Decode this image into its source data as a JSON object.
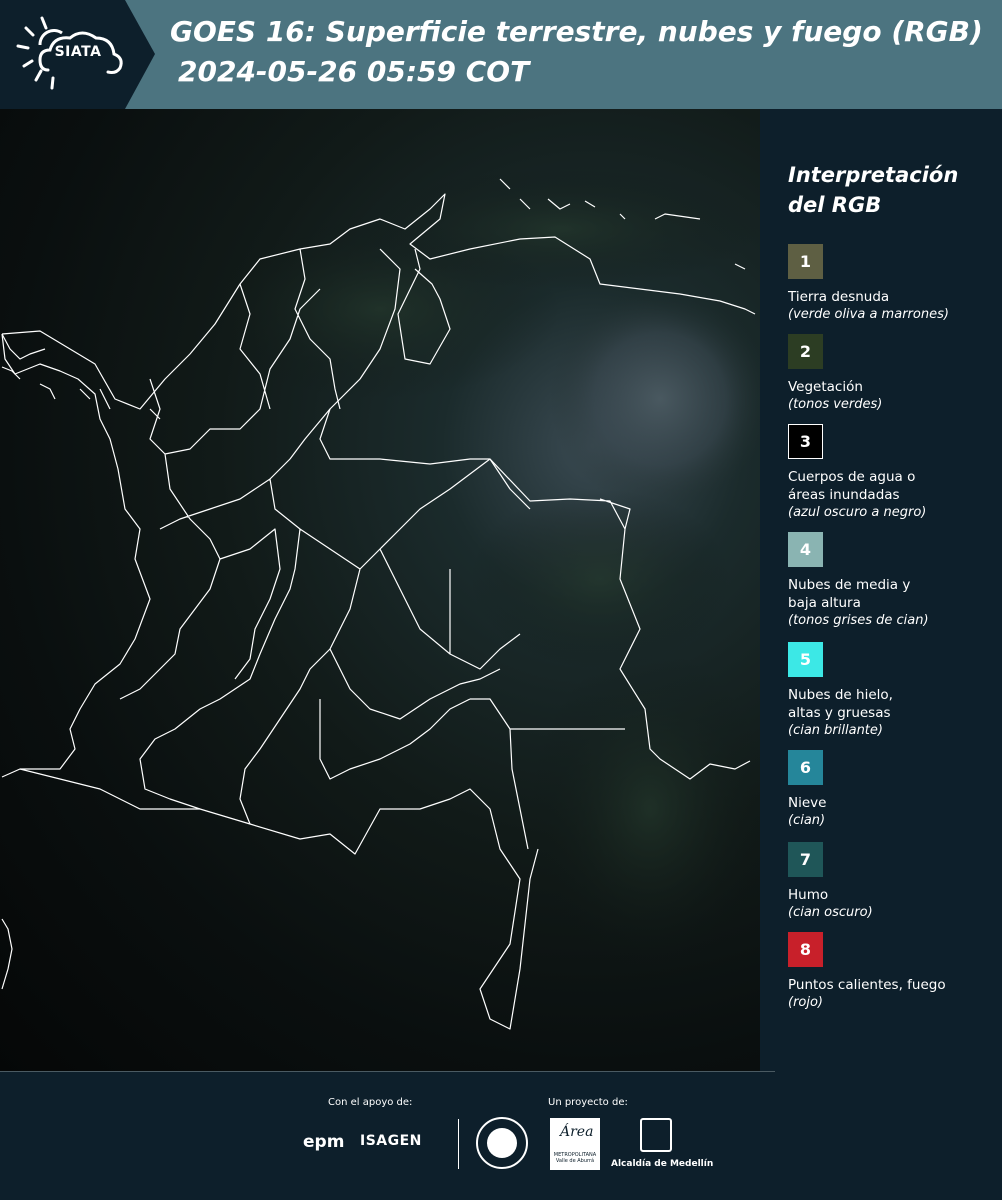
{
  "header": {
    "logo_text": "SIATA",
    "title": "GOES 16: Superficie terrestre, nubes y fuego (RGB)",
    "subtitle": "2024-05-26 05:59 COT"
  },
  "legend": {
    "title_line1": "Interpretación",
    "title_line2": "del RGB",
    "items": [
      {
        "number": "1",
        "color": "#5e5f43",
        "label": "Tierra desnuda",
        "label2": "",
        "note": "(verde oliva a marrones)"
      },
      {
        "number": "2",
        "color": "#2c3d23",
        "label": "Vegetación",
        "label2": "",
        "note": "(tonos verdes)"
      },
      {
        "number": "3",
        "color": "#000000",
        "label": "Cuerpos de agua o",
        "label2": "áreas inundadas",
        "note": "(azul oscuro a negro)"
      },
      {
        "number": "4",
        "color": "#8ab4b2",
        "label": "Nubes de media y",
        "label2": "baja altura",
        "note": "(tonos grises de cian)"
      },
      {
        "number": "5",
        "color": "#3ce8e6",
        "label": "Nubes de hielo,",
        "label2": "altas y gruesas",
        "note": "(cian brillante)"
      },
      {
        "number": "6",
        "color": "#25869a",
        "label": "Nieve",
        "label2": "",
        "note": "(cian)"
      },
      {
        "number": "7",
        "color": "#1f5658",
        "label": "Humo",
        "label2": "",
        "note": "(cian oscuro)"
      },
      {
        "number": "8",
        "color": "#c8202a",
        "label": "Puntos calientes, fuego",
        "label2": "",
        "note": "(rojo)"
      }
    ]
  },
  "footer": {
    "support_label": "Con el apoyo de:",
    "project_label": "Un proyecto de:",
    "sponsor1": "epm",
    "sponsor2": "ISAGEN",
    "partner_area": "Área",
    "partner_area_sub": "METROPOLITANA Valle de Aburrá",
    "partner_alcaldia": "Alcaldía de Medellín"
  },
  "colors": {
    "header_bg": "#4c7480",
    "logo_bg": "#0d1f2b",
    "page_bg": "#0d1f2b",
    "map_outline": "#ffffff"
  }
}
